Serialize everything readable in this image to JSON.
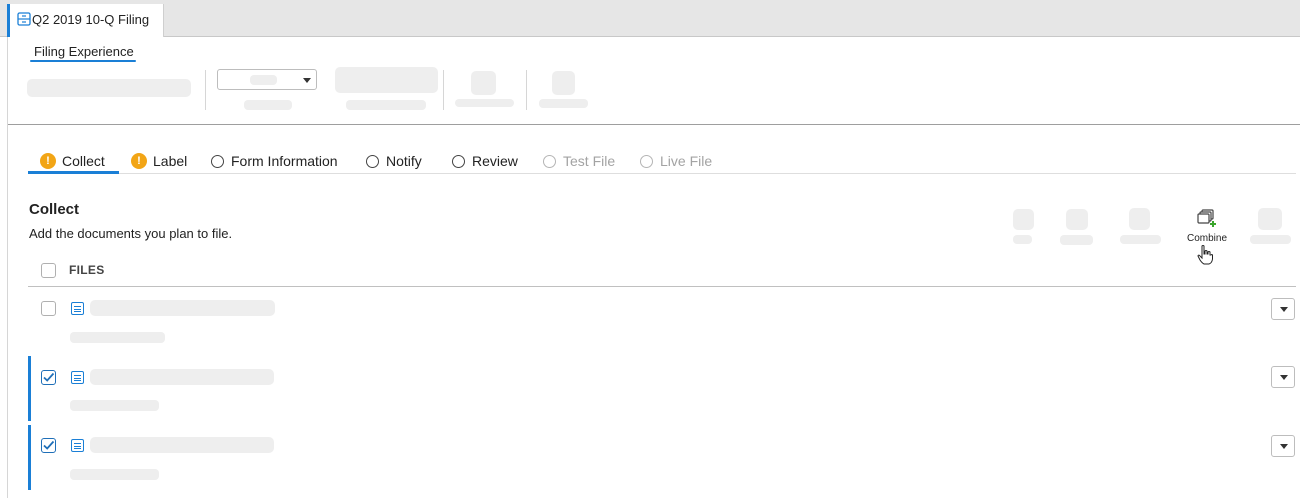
{
  "window": {
    "document_tab": {
      "label": "Q2 2019 10-Q Filing",
      "icon": "filing-cabinet-icon"
    }
  },
  "sub_tabs": [
    {
      "label": "Filing Experience",
      "active": true
    }
  ],
  "steps": [
    {
      "label": "Collect",
      "status": "warning",
      "active": true
    },
    {
      "label": "Label",
      "status": "warning",
      "active": false
    },
    {
      "label": "Form Information",
      "status": "pending",
      "active": false
    },
    {
      "label": "Notify",
      "status": "pending",
      "active": false
    },
    {
      "label": "Review",
      "status": "pending",
      "active": false
    },
    {
      "label": "Test File",
      "status": "disabled",
      "active": false
    },
    {
      "label": "Live File",
      "status": "disabled",
      "active": false
    }
  ],
  "section": {
    "title": "Collect",
    "subtitle": "Add the documents you plan to file."
  },
  "toolbar": {
    "combine": {
      "label": "Combine",
      "icon": "combine-documents-icon"
    }
  },
  "files": {
    "header_label": "FILES",
    "rows": [
      {
        "checked": false,
        "icon": "document-icon"
      },
      {
        "checked": true,
        "icon": "document-icon"
      },
      {
        "checked": true,
        "icon": "document-icon"
      }
    ]
  },
  "colors": {
    "accent": "#1a7fd6",
    "warning": "#f2a516",
    "add": "#3aa52c"
  }
}
